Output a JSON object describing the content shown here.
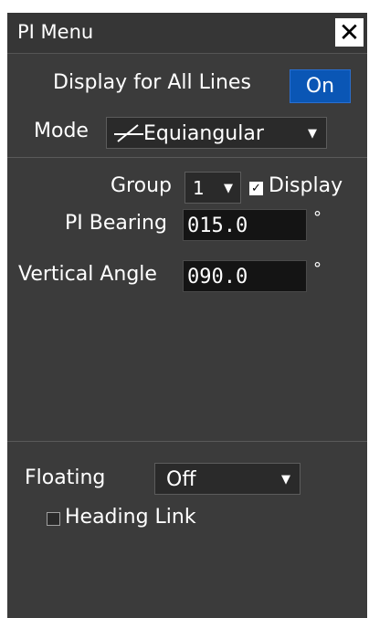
{
  "window": {
    "title": "PI Menu",
    "close_glyph": "✕"
  },
  "display_all": {
    "label": "Display for All Lines",
    "state": "On"
  },
  "mode": {
    "label": "Mode",
    "icon": "equiangular-icon",
    "value": "Equiangular",
    "arrow": "▼"
  },
  "group": {
    "label": "Group",
    "value": "1",
    "arrow": "▼",
    "display_label": "Display",
    "display_checked": true,
    "check_glyph": "✓"
  },
  "pi_bearing": {
    "label": "PI Bearing",
    "value": "015.0",
    "unit": "°"
  },
  "vertical_angle": {
    "label": "Vertical Angle",
    "value": "090.0",
    "unit": "°"
  },
  "floating": {
    "label": "Floating",
    "value": "Off",
    "arrow": "▼"
  },
  "heading_link": {
    "label": "Heading Link",
    "checked": false
  },
  "colors": {
    "accent": "#0a56b5",
    "panel": "#3b3b3b",
    "field": "#141414"
  }
}
